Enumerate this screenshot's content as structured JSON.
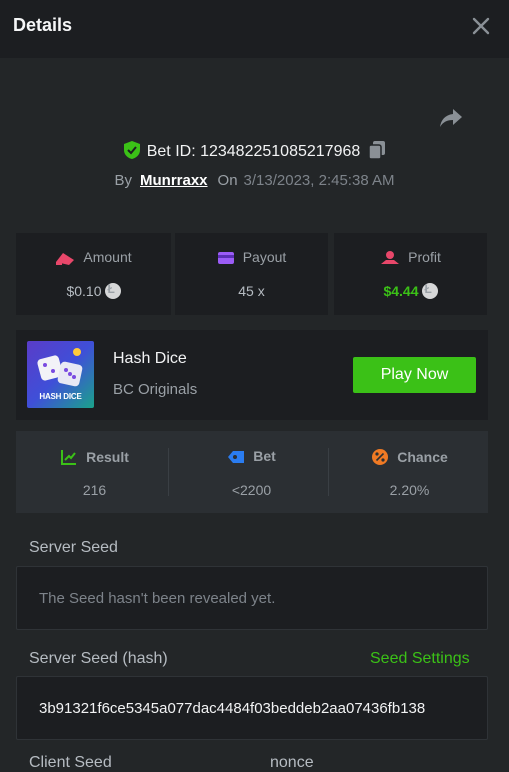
{
  "header": {
    "title": "Details"
  },
  "bet": {
    "id_label": "Bet ID: 123482251085217968",
    "by_label": "By",
    "username": "Munrraxx",
    "on_label": "On",
    "datetime": "3/13/2023, 2:45:38 AM"
  },
  "stats": {
    "amount": {
      "label": "Amount",
      "value": "$0.10"
    },
    "payout": {
      "label": "Payout",
      "value": "45 x"
    },
    "profit": {
      "label": "Profit",
      "value": "$4.44"
    }
  },
  "game": {
    "thumb_label": "HASH DICE",
    "name": "Hash Dice",
    "provider": "BC Originals",
    "play_label": "Play Now"
  },
  "result": {
    "result_label": "Result",
    "result_value": "216",
    "bet_label": "Bet",
    "bet_value": "<2200",
    "chance_label": "Chance",
    "chance_value": "2.20%"
  },
  "server_seed": {
    "label": "Server Seed",
    "value": "The Seed hasn't been revealed yet."
  },
  "server_seed_hash": {
    "label": "Server Seed (hash)",
    "settings_link": "Seed Settings",
    "value": "3b91321f6ce5345a077dac4484f03beddeb2aa07436fb138"
  },
  "footer_labels": {
    "client_seed": "Client Seed",
    "nonce": "nonce"
  },
  "colors": {
    "accent_green": "#3bc117",
    "background": "#232628",
    "panel": "#1c1e21"
  },
  "icons": [
    "close-icon",
    "share-icon",
    "verified-shield-icon",
    "copy-icon",
    "amount-icon",
    "payout-icon",
    "profit-icon",
    "result-chart-icon",
    "bet-tag-icon",
    "chance-percent-icon",
    "coin-icon"
  ]
}
